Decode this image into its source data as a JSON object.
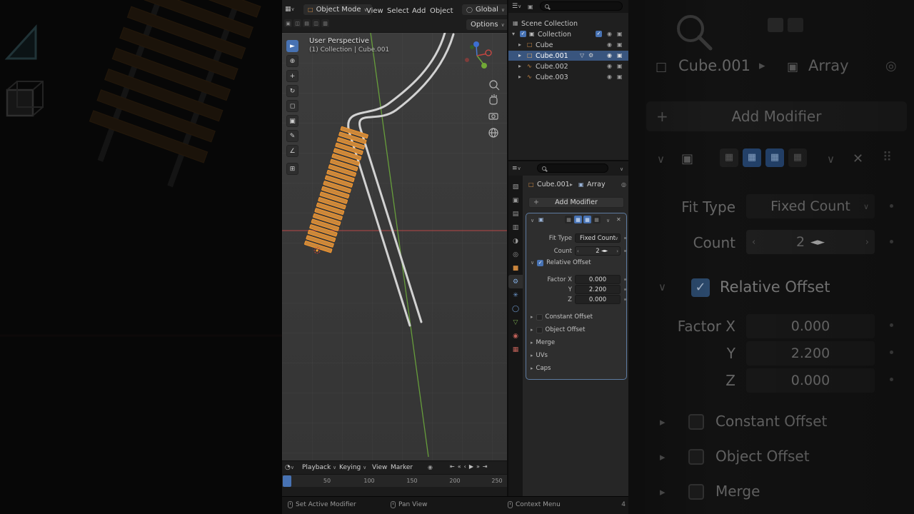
{
  "colors": {
    "accent_blue": "#4772b3",
    "selection_bg": "#39557e",
    "object_orange": "#e0963c",
    "axis_x_red": "#b04848",
    "axis_y_green": "#6ca93c",
    "rail_gray": "#d2d2d2",
    "sleeper_fill": "#c9873c",
    "sleeper_outline": "#ff9a2a"
  },
  "icons": {
    "chev_down": "∨",
    "chev_right": "▸",
    "chev_open": "▾",
    "close": "✕",
    "plus": "+",
    "pin": "◎",
    "eye": "◉",
    "camera": "▣",
    "check": "✓",
    "filter": "▽",
    "menu": "☰",
    "editor_3d": "▦",
    "editor_props": "≡",
    "editor_timeline": "◔",
    "mesh_object": "□",
    "mesh_data": "▽",
    "curve_object": "∿",
    "collection": "▣",
    "scene": "▦",
    "globe": "◯",
    "wrench": "⚙",
    "array": "▣",
    "grip": "⠿",
    "anim_dot": "•",
    "record": "◉",
    "jump_start": "⇤",
    "prev_key": "«",
    "prev_frame": "‹",
    "play": "▶",
    "next_key": "»",
    "jump_end": "⇥",
    "field_prev": "‹",
    "field_next": "›",
    "drag_cursor": "◄►",
    "display_toggle": "▦"
  },
  "viewport": {
    "header": {
      "mode": "Object Mode",
      "menus": [
        "View",
        "Select",
        "Add",
        "Object"
      ],
      "orientation": "Global",
      "options": "Options",
      "row2_glyphs": [
        "▣",
        "◫",
        "▤",
        "◫",
        "▥"
      ]
    },
    "toolbar_glyphs": [
      "►",
      "⊕",
      "+",
      "↻",
      "◻",
      "▣",
      "✎",
      "∠",
      "⊞"
    ],
    "overlay": {
      "line1": "User Perspective",
      "line2": "(1) Collection | Cube.001"
    }
  },
  "outliner": {
    "scene": "Scene Collection",
    "collection": "Collection",
    "objects": [
      "Cube",
      "Cube.001",
      "Cube.002",
      "Cube.003"
    ]
  },
  "properties": {
    "tabs_glyphs": [
      "▧",
      "▣",
      "▤",
      "▥",
      "◑",
      "◎",
      "■",
      "⚙",
      "✳",
      "◯",
      "▽",
      "◉",
      "▦"
    ],
    "breadcrumb": {
      "object": "Cube.001",
      "modifier": "Array"
    },
    "add_modifier": "Add Modifier",
    "modifier": {
      "fit_type_label": "Fit Type",
      "fit_type_value": "Fixed Count",
      "count_label": "Count",
      "count_value": "2",
      "relative_offset": "Relative Offset",
      "factor_x_label": "Factor X",
      "factor_x": "0.000",
      "factor_y_label": "Y",
      "factor_y": "2.200",
      "factor_z_label": "Z",
      "factor_z": "0.000",
      "constant_offset": "Constant Offset",
      "object_offset": "Object Offset",
      "merge": "Merge",
      "uvs": "UVs",
      "caps": "Caps"
    }
  },
  "timeline": {
    "menus": [
      "Playback",
      "Keying",
      "View",
      "Marker"
    ],
    "frames": [
      "50",
      "100",
      "150",
      "200",
      "250"
    ]
  },
  "statusbar": {
    "left": "Set Active Modifier",
    "middle": "Pan View",
    "right": "Context Menu",
    "version": "4"
  }
}
